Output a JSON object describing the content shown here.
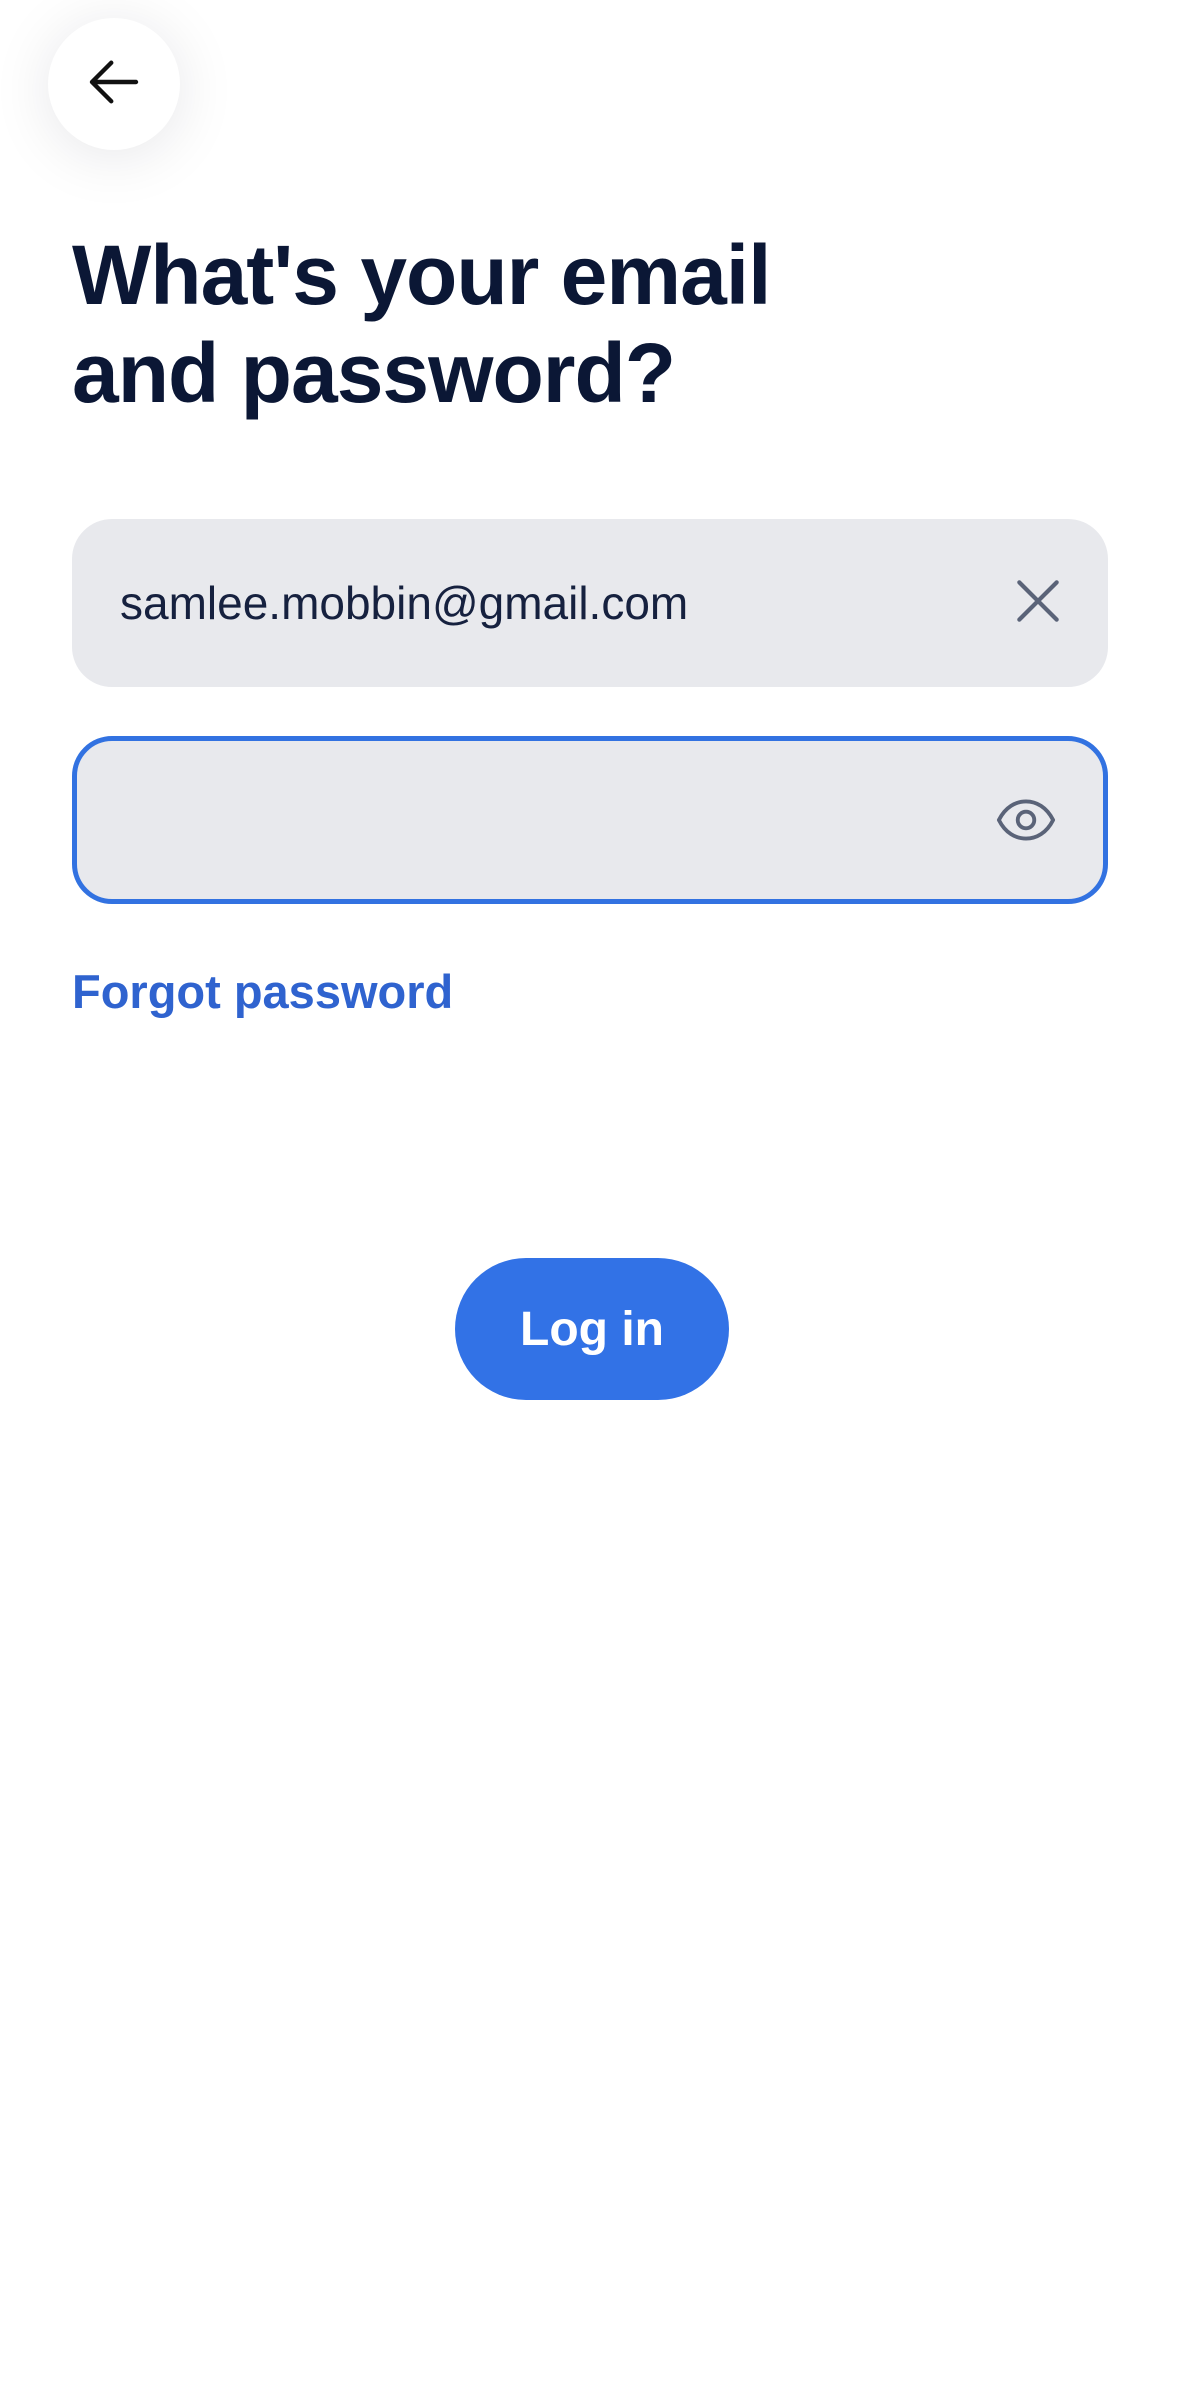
{
  "header": {
    "back_icon": "arrow-left-icon"
  },
  "title": "What's your email\nand password?",
  "email_field": {
    "value": "samlee.mobbin@gmail.com",
    "clear_icon": "close-icon"
  },
  "password_field": {
    "value": "",
    "visibility_icon": "eye-icon"
  },
  "forgot_password": "Forgot password",
  "login_button": "Log in",
  "colors": {
    "accent": "#3272e6",
    "link": "#2f63cf",
    "title": "#0b1735",
    "field_bg": "#e8e9ed",
    "icon_gray": "#5a6378"
  }
}
